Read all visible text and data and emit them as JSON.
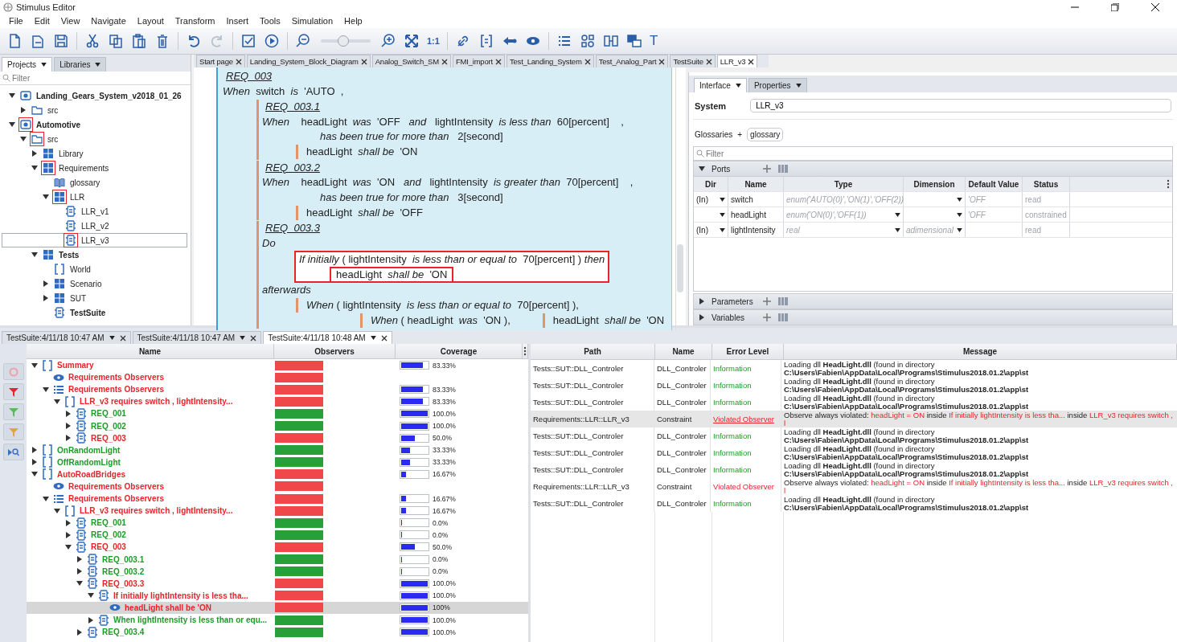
{
  "window": {
    "title": "Stimulus Editor"
  },
  "menu": [
    "File",
    "Edit",
    "View",
    "Navigate",
    "Layout",
    "Transform",
    "Insert",
    "Tools",
    "Simulation",
    "Help"
  ],
  "toolbar": {
    "zoom_slider": {
      "level": 0.45
    },
    "zoom_label": "1:1",
    "text_tool": "T"
  },
  "project_panel": {
    "tabs": [
      {
        "label": "Projects",
        "selected": true
      },
      {
        "label": "Libraries",
        "selected": false
      }
    ],
    "filter_placeholder": "Filter",
    "tree": [
      {
        "label": "Landing_Gears_System_v2018_01_26",
        "kind": "project",
        "bold": true,
        "marked": false,
        "selected": false,
        "expanded": true,
        "children": [
          {
            "label": "src",
            "kind": "folder",
            "bold": false,
            "marked": false,
            "selected": false,
            "expanded": false
          }
        ]
      },
      {
        "label": "Automotive",
        "kind": "project",
        "bold": true,
        "marked": true,
        "selected": false,
        "expanded": true,
        "children": [
          {
            "label": "src",
            "kind": "folder",
            "bold": false,
            "marked": true,
            "selected": false,
            "expanded": true,
            "children": [
              {
                "label": "Library",
                "kind": "package",
                "bold": false,
                "marked": false,
                "selected": false,
                "expanded": false
              },
              {
                "label": "Requirements",
                "kind": "package",
                "bold": false,
                "marked": true,
                "selected": false,
                "expanded": true,
                "children": [
                  {
                    "label": "glossary",
                    "kind": "book",
                    "bold": false,
                    "marked": false,
                    "selected": false
                  },
                  {
                    "label": "LLR",
                    "kind": "package",
                    "bold": false,
                    "marked": true,
                    "selected": false,
                    "expanded": true,
                    "children": [
                      {
                        "label": "LLR_v1",
                        "kind": "req",
                        "bold": false,
                        "marked": false,
                        "selected": false
                      },
                      {
                        "label": "LLR_v2",
                        "kind": "req",
                        "bold": false,
                        "marked": false,
                        "selected": false
                      },
                      {
                        "label": "LLR_v3",
                        "kind": "req",
                        "bold": false,
                        "marked": true,
                        "selected": true
                      }
                    ]
                  }
                ]
              },
              {
                "label": "Tests",
                "kind": "package",
                "bold": true,
                "marked": false,
                "selected": false,
                "expanded": true,
                "children": [
                  {
                    "label": "World",
                    "kind": "block",
                    "bold": false,
                    "marked": false,
                    "selected": false
                  },
                  {
                    "label": "Scenario",
                    "kind": "package",
                    "bold": false,
                    "marked": false,
                    "selected": false,
                    "expanded": false
                  },
                  {
                    "label": "SUT",
                    "kind": "package",
                    "bold": false,
                    "marked": false,
                    "selected": false,
                    "expanded": false
                  },
                  {
                    "label": "TestSuite",
                    "kind": "suite",
                    "bold": true,
                    "marked": false,
                    "selected": false
                  }
                ]
              }
            ]
          }
        ]
      }
    ]
  },
  "editor_tabs": [
    {
      "label": "Start page",
      "selected": false
    },
    {
      "label": "Landing_System_Block_Diagram",
      "selected": false
    },
    {
      "label": "Analog_Switch_SM",
      "selected": false
    },
    {
      "label": "FMI_import",
      "selected": false
    },
    {
      "label": "Test_Landing_System",
      "selected": false
    },
    {
      "label": "Test_Analog_Part",
      "selected": false
    },
    {
      "label": "TestSuite",
      "selected": false
    },
    {
      "label": "LLR_v3",
      "selected": true
    }
  ],
  "editor": {
    "heading": "REQ_003",
    "lines": [
      {
        "kind": "plain",
        "segments": [
          "*When*  switch  *is*  'AUTO  ,"
        ]
      }
    ],
    "blocks": [
      {
        "heading": "REQ_003.1",
        "lines": [
          {
            "kind": "plain",
            "segments": [
              "*When*    headLight  *was*  'OFF   *and*   lightIntensity  *is less than*  60[percent]    ,"
            ]
          },
          {
            "kind": "cont",
            "segments": [
              "*has been true for more than*   2[second]"
            ]
          },
          {
            "kind": "then",
            "segments": [
              "headLight  *shall be*  'ON"
            ]
          }
        ]
      },
      {
        "heading": "REQ_003.2",
        "lines": [
          {
            "kind": "plain",
            "segments": [
              "*When*    headLight  *was*  'ON   *and*   lightIntensity  *is greater than*  70[percent]    ,"
            ]
          },
          {
            "kind": "cont",
            "segments": [
              "*has been true for more than*   3[second]"
            ]
          },
          {
            "kind": "then",
            "segments": [
              "headLight  *shall be*  'OFF"
            ]
          }
        ]
      },
      {
        "heading": "REQ_003.3",
        "lines": [
          {
            "kind": "plain",
            "segments": [
              "*Do*"
            ]
          },
          {
            "kind": "box",
            "segments": [
              "*If initially* ( lightIntensity  *is less than or equal to*  70[percent] ) *then*",
              "headLight  *shall be*  'ON"
            ]
          },
          {
            "kind": "plain",
            "segments": [
              "*afterwards*"
            ]
          },
          {
            "kind": "then",
            "segments": [
              "*When* ( lightIntensity  *is less than or equal to*  70[percent] ),"
            ]
          },
          {
            "kind": "deep",
            "segments": [
              "*When* ( headLight  *was*  'ON ),",
              "headLight  *shall be*  'ON"
            ]
          }
        ]
      }
    ]
  },
  "interface": {
    "tabs": [
      {
        "label": "Interface",
        "selected": true
      },
      {
        "label": "Properties",
        "selected": false
      }
    ],
    "system_label": "System",
    "system_value": "LLR_v3",
    "glossaries_label": "Glossaries",
    "glossaries_add": "+",
    "glossary": "glossary",
    "filter_placeholder": "Filter",
    "ports": {
      "title": "Ports",
      "expanded": true,
      "columns": [
        "Dir",
        "Name",
        "Type",
        "Dimension",
        "Default Value",
        "Status"
      ],
      "rows": [
        {
          "dir": "(In)",
          "name": "switch",
          "type": "enum('AUTO(0)','ON(1)','OFF(2))",
          "default": "'OFF",
          "status": "read"
        },
        {
          "name": "headLight",
          "type": "enum('ON(0)','OFF(1))",
          "default": "'OFF",
          "status": "constrained"
        },
        {
          "dir": "(In)",
          "name": "lightIntensity",
          "type": "real",
          "dimension": "adimensional",
          "status": "read"
        }
      ]
    },
    "sections": [
      {
        "title": "Parameters",
        "expanded": false
      },
      {
        "title": "Variables",
        "expanded": false
      }
    ]
  },
  "results_tabs": [
    {
      "label": "TestSuite:4/11/18 10:47 AM",
      "selected": false
    },
    {
      "label": "TestSuite:4/11/18 10:47 AM",
      "selected": false
    },
    {
      "label": "TestSuite:4/11/18 10:48 AM",
      "selected": true
    }
  ],
  "results": {
    "columns": [
      "Name",
      "Observers",
      "Coverage"
    ],
    "rows": [
      {
        "name": "Summary",
        "kind": "block",
        "passed": false,
        "selected": false,
        "expanded": true,
        "level": 0.8333,
        "reading": "83.33%",
        "children": [
          {
            "name": "Requirements Observers",
            "kind": "eye",
            "passed": false,
            "selected": false
          },
          {
            "name": "Requirements Observers",
            "kind": "list",
            "passed": false,
            "selected": false,
            "expanded": true,
            "level": 0.8333,
            "reading": "83.33%",
            "children": [
              {
                "name": "LLR_v3 requires switch ,  lightIntensity...",
                "kind": "block",
                "passed": false,
                "selected": false,
                "expanded": true,
                "level": 0.8333,
                "reading": "83.33%",
                "children": [
                  {
                    "name": "REQ_001",
                    "kind": "req",
                    "passed": true,
                    "selected": false,
                    "expanded": false,
                    "level": 1,
                    "reading": "100.0%"
                  },
                  {
                    "name": "REQ_002",
                    "kind": "req",
                    "passed": true,
                    "selected": false,
                    "expanded": false,
                    "level": 1,
                    "reading": "100.0%"
                  },
                  {
                    "name": "REQ_003",
                    "kind": "req",
                    "passed": false,
                    "selected": false,
                    "expanded": false,
                    "level": 0.5,
                    "reading": "50.0%"
                  }
                ]
              }
            ]
          }
        ]
      },
      {
        "name": "OnRandomLight",
        "kind": "block",
        "passed": true,
        "selected": false,
        "expanded": false,
        "level": 0.3333,
        "reading": "33.33%"
      },
      {
        "name": "OffRandomLight",
        "kind": "block",
        "passed": true,
        "selected": false,
        "expanded": false,
        "level": 0.3333,
        "reading": "33.33%"
      },
      {
        "name": "AutoRoadBridges",
        "kind": "block",
        "passed": false,
        "selected": false,
        "expanded": true,
        "level": 0.1667,
        "reading": "16.67%",
        "children": [
          {
            "name": "Requirements Observers",
            "kind": "eye",
            "passed": false,
            "selected": false
          },
          {
            "name": "Requirements Observers",
            "kind": "list",
            "passed": false,
            "selected": false,
            "expanded": true,
            "level": 0.1667,
            "reading": "16.67%",
            "children": [
              {
                "name": "LLR_v3 requires switch ,  lightIntensity...",
                "kind": "block",
                "passed": false,
                "selected": false,
                "expanded": true,
                "level": 0.1667,
                "reading": "16.67%",
                "children": [
                  {
                    "name": "REQ_001",
                    "kind": "req",
                    "passed": true,
                    "selected": false,
                    "expanded": false,
                    "level": 0,
                    "reading": "0.0%"
                  },
                  {
                    "name": "REQ_002",
                    "kind": "req",
                    "passed": true,
                    "selected": false,
                    "expanded": false,
                    "level": 0,
                    "reading": "0.0%"
                  },
                  {
                    "name": "REQ_003",
                    "kind": "req",
                    "passed": false,
                    "selected": false,
                    "expanded": true,
                    "level": 0.5,
                    "reading": "50.0%",
                    "children": [
                      {
                        "name": "REQ_003.1",
                        "kind": "req",
                        "passed": true,
                        "selected": false,
                        "expanded": false,
                        "level": 0,
                        "reading": "0.0%"
                      },
                      {
                        "name": "REQ_003.2",
                        "kind": "req",
                        "passed": true,
                        "selected": false,
                        "expanded": false,
                        "level": 0,
                        "reading": "0.0%"
                      },
                      {
                        "name": "REQ_003.3",
                        "kind": "req",
                        "passed": false,
                        "selected": false,
                        "expanded": true,
                        "level": 1,
                        "reading": "100.0%",
                        "children": [
                          {
                            "name": "If initially  lightIntensity is less tha...",
                            "kind": "req",
                            "passed": false,
                            "selected": false,
                            "expanded": true,
                            "level": 1,
                            "reading": "100.0%",
                            "children": [
                              {
                                "name": "headLight shall be  'ON",
                                "kind": "eye",
                                "passed": false,
                                "selected": true,
                                "level": 1,
                                "reading": "100%"
                              }
                            ]
                          },
                          {
                            "name": "When  lightIntensity is less than or equ...",
                            "kind": "req",
                            "passed": true,
                            "selected": false,
                            "expanded": false,
                            "level": 1,
                            "reading": "100.0%"
                          }
                        ]
                      },
                      {
                        "name": "REQ_003.4",
                        "kind": "req",
                        "passed": true,
                        "selected": false,
                        "expanded": false,
                        "level": 1,
                        "reading": "100.0%"
                      }
                    ]
                  }
                ]
              }
            ]
          }
        ]
      }
    ]
  },
  "log": {
    "columns": [
      "Path",
      "Name",
      "Error Level",
      "Message"
    ],
    "rows": [
      {
        "path": "Tests::SUT::DLL_Controler",
        "name": "DLL_Controler",
        "kind": "information",
        "level_text": "Information",
        "selected": false,
        "message": [
          {
            "kind": "plain",
            "text": "Loading dll "
          },
          {
            "kind": "bold",
            "text": "HeadLight.dll"
          },
          {
            "kind": "plain",
            "text": " (found in directory "
          },
          {
            "kind": "bold",
            "text": "C:\\Users\\Fabien\\AppData\\Local\\Programs\\Stimulus2018.01.2\\app\\st"
          }
        ]
      },
      {
        "path": "Tests::SUT::DLL_Controler",
        "name": "DLL_Controler",
        "kind": "information",
        "level_text": "Information",
        "selected": false,
        "message": [
          {
            "kind": "plain",
            "text": "Loading dll "
          },
          {
            "kind": "bold",
            "text": "HeadLight.dll"
          },
          {
            "kind": "plain",
            "text": " (found in directory "
          },
          {
            "kind": "bold",
            "text": "C:\\Users\\Fabien\\AppData\\Local\\Programs\\Stimulus2018.01.2\\app\\st"
          }
        ]
      },
      {
        "path": "Tests::SUT::DLL_Controler",
        "name": "DLL_Controler",
        "kind": "information",
        "level_text": "Information",
        "selected": false,
        "message": [
          {
            "kind": "plain",
            "text": "Loading dll "
          },
          {
            "kind": "bold",
            "text": "HeadLight.dll"
          },
          {
            "kind": "plain",
            "text": " (found in directory "
          },
          {
            "kind": "bold",
            "text": "C:\\Users\\Fabien\\AppData\\Local\\Programs\\Stimulus2018.01.2\\app\\st"
          }
        ]
      },
      {
        "path": "Requirements::LLR::LLR_v3",
        "name": "Constraint",
        "kind": "violation",
        "level_text": "Violated Observer",
        "selected": true,
        "message": [
          {
            "kind": "plain",
            "text": "Observe always violated:  "
          },
          {
            "kind": "red",
            "text": "headLight = ON"
          },
          {
            "kind": "plain",
            "text": "  inside  "
          },
          {
            "kind": "red",
            "text": "If initially  lightIntensity is less tha..."
          },
          {
            "kind": "plain",
            "text": "  inside  "
          },
          {
            "kind": "red",
            "text": "LLR_v3 requires switch ,  l"
          }
        ]
      },
      {
        "path": "Tests::SUT::DLL_Controler",
        "name": "DLL_Controler",
        "kind": "information",
        "level_text": "Information",
        "selected": false,
        "message": [
          {
            "kind": "plain",
            "text": "Loading dll "
          },
          {
            "kind": "bold",
            "text": "HeadLight.dll"
          },
          {
            "kind": "plain",
            "text": " (found in directory "
          },
          {
            "kind": "bold",
            "text": "C:\\Users\\Fabien\\AppData\\Local\\Programs\\Stimulus2018.01.2\\app\\st"
          }
        ]
      },
      {
        "path": "Tests::SUT::DLL_Controler",
        "name": "DLL_Controler",
        "kind": "information",
        "level_text": "Information",
        "selected": false,
        "message": [
          {
            "kind": "plain",
            "text": "Loading dll "
          },
          {
            "kind": "bold",
            "text": "HeadLight.dll"
          },
          {
            "kind": "plain",
            "text": " (found in directory "
          },
          {
            "kind": "bold",
            "text": "C:\\Users\\Fabien\\AppData\\Local\\Programs\\Stimulus2018.01.2\\app\\st"
          }
        ]
      },
      {
        "path": "Tests::SUT::DLL_Controler",
        "name": "DLL_Controler",
        "kind": "information",
        "level_text": "Information",
        "selected": false,
        "message": [
          {
            "kind": "plain",
            "text": "Loading dll "
          },
          {
            "kind": "bold",
            "text": "HeadLight.dll"
          },
          {
            "kind": "plain",
            "text": " (found in directory "
          },
          {
            "kind": "bold",
            "text": "C:\\Users\\Fabien\\AppData\\Local\\Programs\\Stimulus2018.01.2\\app\\st"
          }
        ]
      },
      {
        "path": "Requirements::LLR::LLR_v3",
        "name": "Constraint",
        "kind": "violation",
        "level_text": "Violated Observer",
        "selected": false,
        "message": [
          {
            "kind": "plain",
            "text": "Observe always violated:  "
          },
          {
            "kind": "red",
            "text": "headLight = ON"
          },
          {
            "kind": "plain",
            "text": "  inside  "
          },
          {
            "kind": "red",
            "text": "If initially  lightIntensity is less tha..."
          },
          {
            "kind": "plain",
            "text": "  inside  "
          },
          {
            "kind": "red",
            "text": "LLR_v3 requires switch ,  l"
          }
        ]
      },
      {
        "path": "Tests::SUT::DLL_Controler",
        "name": "DLL_Controler",
        "kind": "information",
        "level_text": "Information",
        "selected": false,
        "message": [
          {
            "kind": "plain",
            "text": "Loading dll "
          },
          {
            "kind": "bold",
            "text": "HeadLight.dll"
          },
          {
            "kind": "plain",
            "text": " (found in directory "
          },
          {
            "kind": "bold",
            "text": "C:\\Users\\Fabien\\AppData\\Local\\Programs\\Stimulus2018.01.2\\app\\st"
          }
        ]
      }
    ]
  }
}
